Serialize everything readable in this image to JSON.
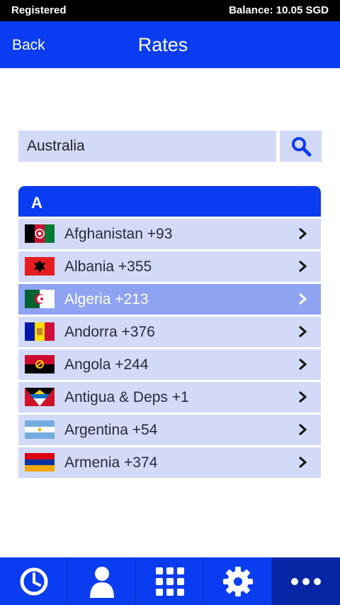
{
  "status": {
    "registration": "Registered",
    "balance": "Balance: 10.05 SGD"
  },
  "app_bar": {
    "back_label": "Back",
    "title": "Rates"
  },
  "search": {
    "value": "Australia",
    "icon": "search-icon"
  },
  "list": {
    "section_letter": "A",
    "selected_index": 2,
    "items": [
      {
        "label": "Afghanistan +93",
        "flag": "afghanistan-flag"
      },
      {
        "label": "Albania +355",
        "flag": "albania-flag"
      },
      {
        "label": "Algeria +213",
        "flag": "algeria-flag"
      },
      {
        "label": "Andorra +376",
        "flag": "andorra-flag"
      },
      {
        "label": "Angola +244",
        "flag": "angola-flag"
      },
      {
        "label": "Antigua & Deps +1",
        "flag": "antigua-flag"
      },
      {
        "label": "Argentina +54",
        "flag": "argentina-flag"
      },
      {
        "label": "Armenia +374",
        "flag": "armenia-flag"
      }
    ]
  },
  "tab_bar": {
    "active_index": 4,
    "tabs": [
      {
        "icon": "clock-icon"
      },
      {
        "icon": "contact-icon"
      },
      {
        "icon": "dialpad-icon"
      },
      {
        "icon": "gear-icon"
      },
      {
        "icon": "more-icon"
      }
    ]
  },
  "colors": {
    "primary": "#0a3cf2",
    "row_bg": "#d3daf8",
    "row_selected": "#8fa3f3"
  }
}
